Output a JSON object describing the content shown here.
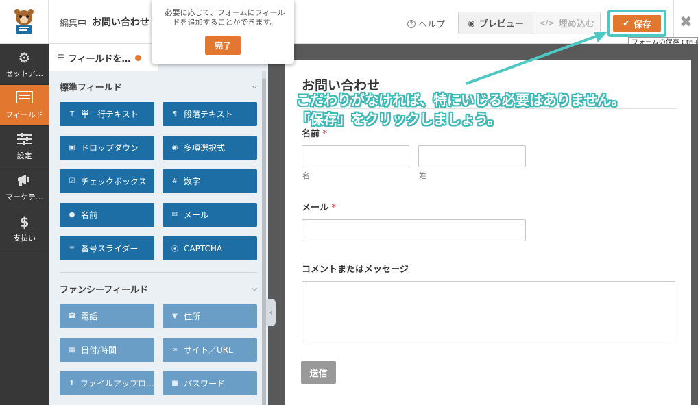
{
  "header": {
    "edit_prefix": "編集中",
    "form_title": "お問い合わせ",
    "help_label": "ヘルプ",
    "preview_label": "プレビュー",
    "embed_label": "埋め込む",
    "save_label": "保存",
    "save_tooltip": "フォームの保存 Ctrl+"
  },
  "sidebar": {
    "items": [
      {
        "label": "セットア…",
        "icon": "gear-icon"
      },
      {
        "label": "フィールド",
        "icon": "fields-list-icon"
      },
      {
        "label": "設定",
        "icon": "sliders-icon"
      },
      {
        "label": "マーケテ…",
        "icon": "megaphone-icon"
      },
      {
        "label": "支払い",
        "icon": "dollar-icon"
      }
    ]
  },
  "fields_panel": {
    "tab_label": "フィールドを…",
    "standard_section": "標準フィールド",
    "fancy_section": "ファンシーフィールド",
    "standard_fields": [
      {
        "label": "単一行テキスト",
        "icon": "text-cursor-icon"
      },
      {
        "label": "段落テキスト",
        "icon": "paragraph-icon"
      },
      {
        "label": "ドロップダウン",
        "icon": "dropdown-icon"
      },
      {
        "label": "多項選択式",
        "icon": "radio-icon"
      },
      {
        "label": "チェックボックス",
        "icon": "checkbox-icon"
      },
      {
        "label": "数字",
        "icon": "hash-icon"
      },
      {
        "label": "名前",
        "icon": "user-icon"
      },
      {
        "label": "メール",
        "icon": "envelope-icon"
      },
      {
        "label": "番号スライダー",
        "icon": "slider-icon"
      },
      {
        "label": "CAPTCHA",
        "icon": "captcha-icon"
      }
    ],
    "fancy_fields": [
      {
        "label": "電話",
        "icon": "phone-icon"
      },
      {
        "label": "住所",
        "icon": "map-pin-icon"
      },
      {
        "label": "日付/時間",
        "icon": "calendar-icon"
      },
      {
        "label": "サイト／URL",
        "icon": "link-icon"
      },
      {
        "label": "ファイルアップロ…",
        "icon": "upload-icon"
      },
      {
        "label": "パスワード",
        "icon": "lock-icon"
      }
    ]
  },
  "popover": {
    "text": "必要に応じて、フォームにフィールドを追加することができます。",
    "done_label": "完了"
  },
  "form": {
    "title": "お問い合わせ",
    "name_label": "名前",
    "first_sublabel": "名",
    "last_sublabel": "姓",
    "email_label": "メール",
    "comment_label": "コメントまたはメッセージ",
    "required_mark": "*",
    "submit_label": "送信"
  },
  "annotation": {
    "line1": "こだわりがなければ、特にいじる必要はありません。",
    "line2": "「保存」をクリックしましょう。",
    "color": "#3bbab5"
  },
  "colors": {
    "accent": "#e27730",
    "field_button": "#1c6ea4",
    "fancy_field_button": "#6a9ec6",
    "sidebar_bg": "#373737"
  }
}
